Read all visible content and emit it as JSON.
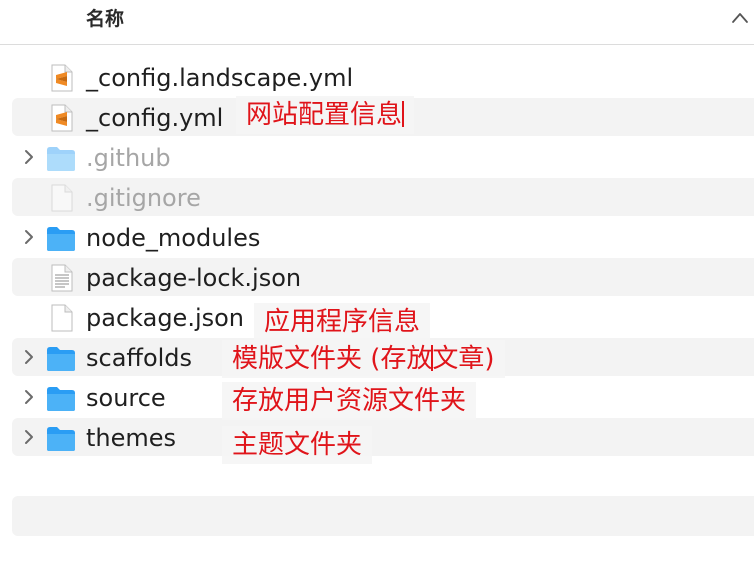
{
  "header": {
    "column_name": "名称"
  },
  "files": [
    {
      "name": "_config.landscape.yml",
      "kind": "sublime",
      "expandable": false,
      "dim": false,
      "stripe": false
    },
    {
      "name": "_config.yml",
      "kind": "sublime",
      "expandable": false,
      "dim": false,
      "stripe": true
    },
    {
      "name": ".github",
      "kind": "folder",
      "expandable": true,
      "dim": true,
      "stripe": false
    },
    {
      "name": ".gitignore",
      "kind": "doc-blank",
      "expandable": false,
      "dim": true,
      "stripe": true
    },
    {
      "name": "node_modules",
      "kind": "folder",
      "expandable": true,
      "dim": false,
      "stripe": false
    },
    {
      "name": "package-lock.json",
      "kind": "doc-lines",
      "expandable": false,
      "dim": false,
      "stripe": true
    },
    {
      "name": "package.json",
      "kind": "doc-blank",
      "expandable": false,
      "dim": false,
      "stripe": false
    },
    {
      "name": "scaffolds",
      "kind": "folder",
      "expandable": true,
      "dim": false,
      "stripe": true
    },
    {
      "name": "source",
      "kind": "folder",
      "expandable": true,
      "dim": false,
      "stripe": false
    },
    {
      "name": "themes",
      "kind": "folder",
      "expandable": true,
      "dim": false,
      "stripe": true
    }
  ],
  "annotations": {
    "config": "网站配置信息",
    "package": "应用程序信息",
    "scaffolds_a": "模版文件夹 (存放",
    "scaffolds_b": "文章)",
    "source": "存放用户资源文件夹",
    "themes": "主题文件夹"
  },
  "colors": {
    "annotation": "#e0141a",
    "folder": "#2a9df4",
    "stripe": "#f3f3f3"
  }
}
